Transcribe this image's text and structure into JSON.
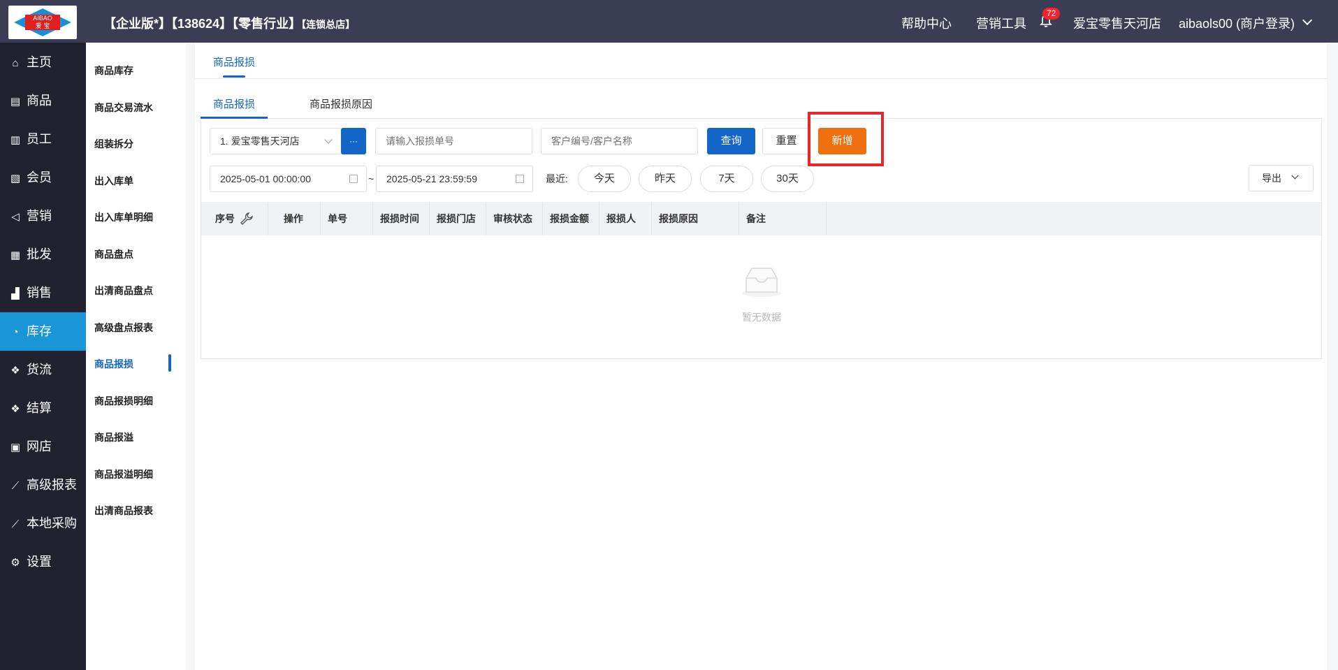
{
  "header": {
    "logo_text_top": "AIBAO",
    "logo_text_bottom": "爱 宝",
    "title_main": "【企业版*】【138624】【零售行业】",
    "title_tag": "【连锁总店】",
    "help": "帮助中心",
    "marketing_tools": "营销工具",
    "notification_count": "72",
    "store_name": "爱宝零售天河店",
    "user": "aibaols00 (商户登录)"
  },
  "sidebar": {
    "items": [
      {
        "label": "主页",
        "icon": "home-icon",
        "glyph": "⌂"
      },
      {
        "label": "商品",
        "icon": "product-icon",
        "glyph": "▤"
      },
      {
        "label": "员工",
        "icon": "staff-icon",
        "glyph": "▥"
      },
      {
        "label": "会员",
        "icon": "member-icon",
        "glyph": "▧"
      },
      {
        "label": "营销",
        "icon": "megaphone-icon",
        "glyph": "◁"
      },
      {
        "label": "批发",
        "icon": "wholesale-icon",
        "glyph": "▦"
      },
      {
        "label": "销售",
        "icon": "sales-chart-icon",
        "glyph": "▟"
      },
      {
        "label": "库存",
        "icon": "pie-chart-icon",
        "glyph": "◔"
      },
      {
        "label": "货流",
        "icon": "logistics-icon",
        "glyph": "❖"
      },
      {
        "label": "结算",
        "icon": "settlement-icon",
        "glyph": "❖"
      },
      {
        "label": "网店",
        "icon": "gift-icon",
        "glyph": "▣"
      },
      {
        "label": "高级报表",
        "icon": "line-chart-icon",
        "glyph": "⟋"
      },
      {
        "label": "本地采购",
        "icon": "purchase-chart-icon",
        "glyph": "⟋"
      },
      {
        "label": "设置",
        "icon": "gear-icon",
        "glyph": "⚙"
      }
    ],
    "active_index": 7
  },
  "submenu": {
    "items": [
      "商品库存",
      "商品交易流水",
      "组装拆分",
      "出入库单",
      "出入库单明细",
      "商品盘点",
      "出清商品盘点",
      "高级盘点报表",
      "商品报损",
      "商品报损明细",
      "商品报溢",
      "商品报溢明细",
      "出清商品报表"
    ],
    "active_index": 8
  },
  "page_tab": "商品报损",
  "subtabs": [
    "商品报损",
    "商品报损原因"
  ],
  "filters": {
    "store_select": "1. 爱宝零售天河店",
    "more_button": "···",
    "order_no_placeholder": "请输入报损单号",
    "customer_placeholder": "客户编号/客户名称",
    "query": "查询",
    "reset": "重置",
    "add": "新增",
    "date_start": "2025-05-01 00:00:00",
    "date_sep": "~",
    "date_end": "2025-05-21 23:59:59",
    "recent_label": "最近:",
    "recent": [
      "今天",
      "昨天",
      "7天",
      "30天"
    ],
    "export": "导出"
  },
  "table": {
    "columns": [
      "序号",
      "操作",
      "单号",
      "报损时间",
      "报损门店",
      "审核状态",
      "报损金额",
      "报损人",
      "报损原因",
      "备注"
    ],
    "empty_text": "暂无数据"
  },
  "colors": {
    "accent": "#1366c8",
    "sidebar_active": "#1996d8",
    "add_button": "#f07010",
    "highlight": "#e8262c"
  }
}
